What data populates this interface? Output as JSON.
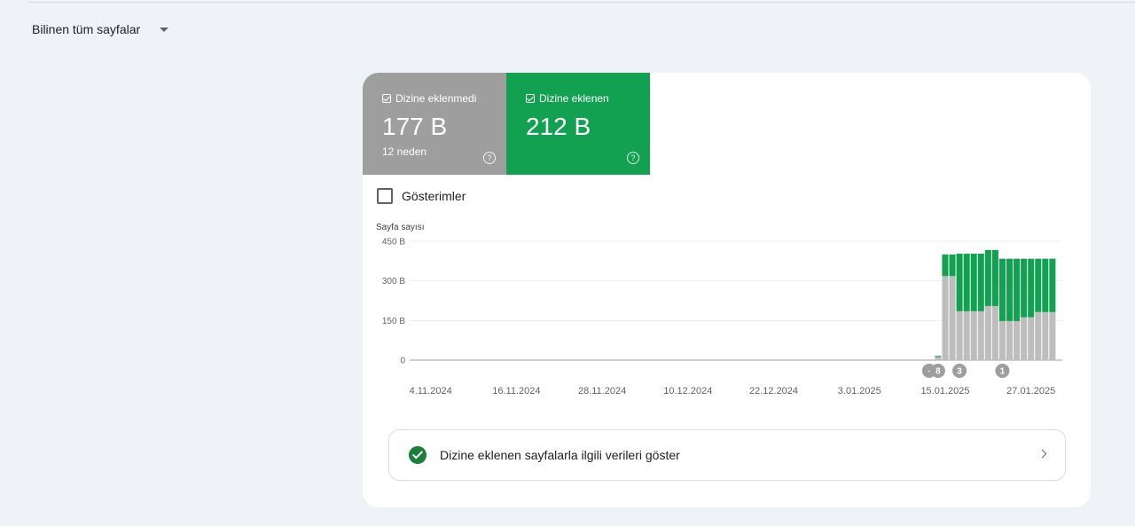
{
  "filter": {
    "label": "Bilinen tüm sayfalar"
  },
  "tiles": {
    "not_indexed": {
      "label": "Dizine eklenmedi",
      "value": "177 B",
      "sub": "12 neden",
      "color": "#9e9e9e"
    },
    "indexed": {
      "label": "Dizine eklenen",
      "value": "212 B",
      "color": "#12a150"
    }
  },
  "impressions": {
    "label": "Gösterimler",
    "checked": false
  },
  "chart_data": {
    "type": "bar",
    "stacked": true,
    "ylabel": "Sayfa sayısı",
    "ylim": [
      0,
      450
    ],
    "yticks": [
      0,
      150,
      300,
      450
    ],
    "ytick_labels": [
      "0",
      "150 B",
      "300 B",
      "450 B"
    ],
    "x_start": "2024-11-02",
    "xtick_labels": [
      "4.11.2024",
      "16.11.2024",
      "28.11.2024",
      "10.12.2024",
      "22.12.2024",
      "3.01.2025",
      "15.01.2025",
      "27.01.2025"
    ],
    "series": [
      {
        "name": "Dizine eklenmedi",
        "color": "#bdbdbd",
        "values": [
          0,
          0,
          0,
          0,
          0,
          0,
          0,
          0,
          0,
          0,
          0,
          0,
          0,
          0,
          0,
          0,
          0,
          0,
          0,
          0,
          0,
          0,
          0,
          0,
          0,
          0,
          0,
          0,
          0,
          0,
          0,
          0,
          0,
          0,
          0,
          0,
          0,
          0,
          0,
          0,
          0,
          0,
          0,
          0,
          0,
          0,
          0,
          0,
          0,
          0,
          0,
          0,
          0,
          0,
          0,
          0,
          0,
          0,
          0,
          0,
          0,
          0,
          0,
          0,
          0,
          0,
          0,
          0,
          0,
          0,
          0,
          0,
          0,
          12,
          318,
          318,
          185,
          185,
          185,
          185,
          205,
          205,
          148,
          148,
          148,
          162,
          162,
          182,
          182,
          182
        ]
      },
      {
        "name": "Dizine eklenen",
        "color": "#12a150",
        "values": [
          0,
          0,
          0,
          0,
          0,
          0,
          0,
          0,
          0,
          0,
          0,
          0,
          0,
          0,
          0,
          0,
          0,
          0,
          0,
          0,
          0,
          0,
          0,
          0,
          0,
          0,
          0,
          0,
          0,
          0,
          0,
          0,
          0,
          0,
          0,
          0,
          0,
          0,
          0,
          0,
          0,
          0,
          0,
          0,
          0,
          0,
          0,
          0,
          0,
          0,
          0,
          0,
          0,
          0,
          0,
          0,
          0,
          0,
          0,
          0,
          0,
          0,
          0,
          0,
          0,
          0,
          0,
          0,
          0,
          0,
          0,
          0,
          0,
          4,
          82,
          82,
          218,
          218,
          218,
          218,
          212,
          212,
          236,
          236,
          236,
          222,
          222,
          202,
          202,
          202
        ]
      }
    ],
    "annotations": [
      {
        "label": "8",
        "x_index": 73
      },
      {
        "label": "3",
        "x_index": 76
      },
      {
        "label": "1",
        "x_index": 82
      }
    ]
  },
  "data_link": {
    "label": "Dizine eklenen sayfalarla ilgili verileri göster"
  }
}
